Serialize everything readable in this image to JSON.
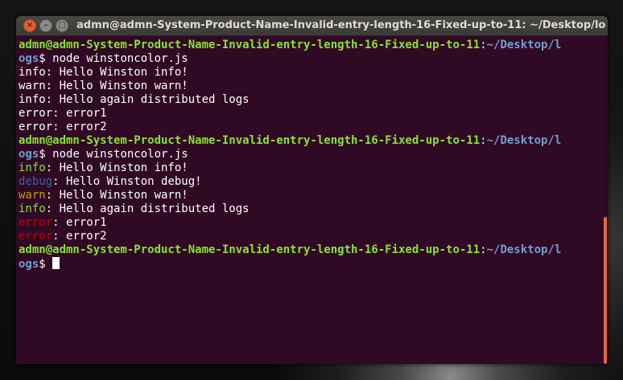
{
  "window": {
    "title": "admn@admn-System-Product-Name-Invalid-entry-length-16-Fixed-up-to-11: ~/Desktop/lo"
  },
  "buttons": {
    "close": "×",
    "minimize": "–",
    "maximize": "□"
  },
  "prompt": {
    "userhost": "admn@admn-System-Product-Name-Invalid-entry-length-16-Fixed-up-to-11",
    "colon": ":",
    "path_part1": "~/Desktop/l",
    "path_part2": "ogs",
    "symbol": "$ "
  },
  "run1": {
    "command": "node winstoncolor.js",
    "lines": [
      "info: Hello Winston info!",
      "warn: Hello Winston warn!",
      "info: Hello again distributed logs",
      "error: error1",
      "error: error2"
    ]
  },
  "run2": {
    "command": "node winstoncolor.js",
    "lines": [
      {
        "level": "info",
        "message": ": Hello Winston info!"
      },
      {
        "level": "debug",
        "message": ": Hello Winston debug!"
      },
      {
        "level": "warn",
        "message": ": Hello Winston warn!"
      },
      {
        "level": "info",
        "message": ": Hello again distributed logs"
      },
      {
        "level": "error",
        "message": ": error1"
      },
      {
        "level": "error",
        "message": ": error2"
      }
    ]
  },
  "colors": {
    "background": "#300a24",
    "prompt_green": "#8ae234",
    "path_blue": "#729fcf",
    "info": "#8ae234",
    "debug": "#3465a4",
    "warn": "#c4a000",
    "error": "#cc0000"
  }
}
